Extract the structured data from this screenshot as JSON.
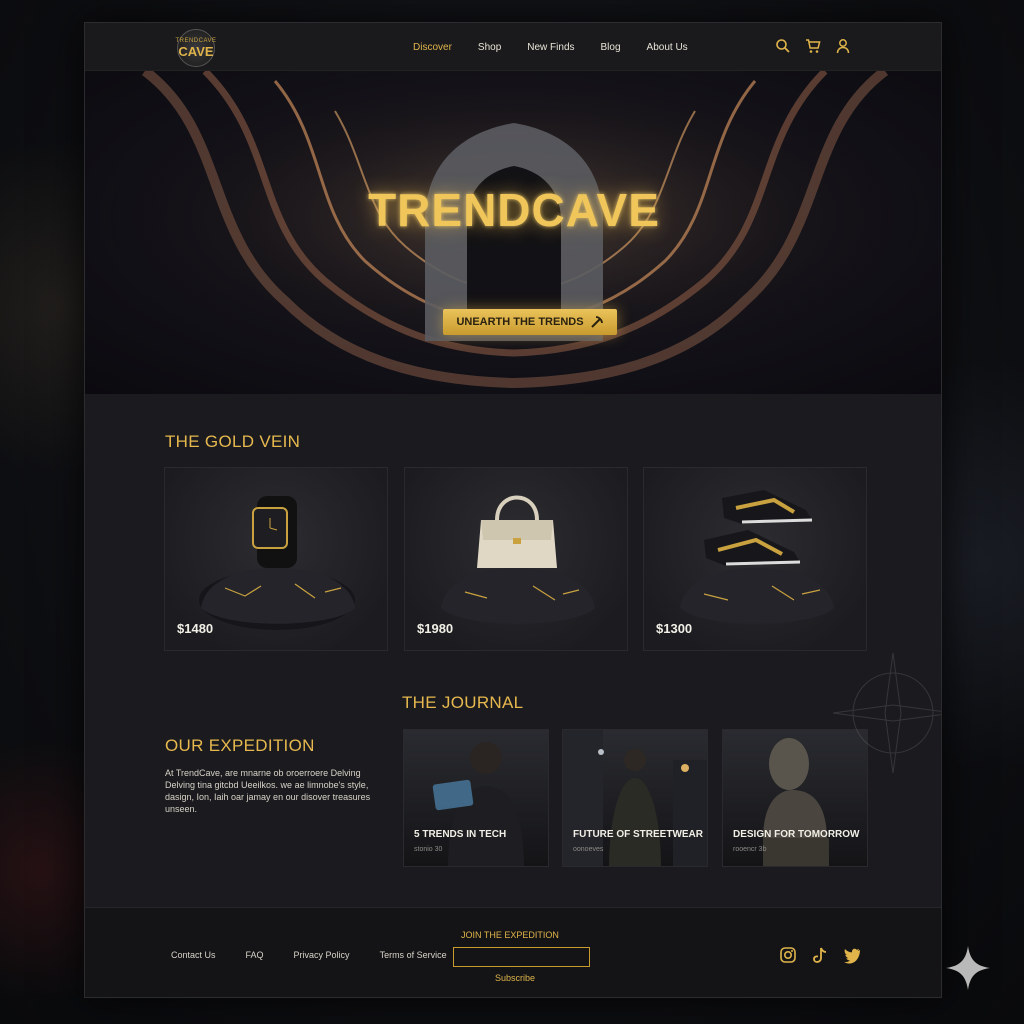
{
  "brand": {
    "logo_top": "TRENDCAVE",
    "logo_main": "CAVE"
  },
  "nav": {
    "items": [
      {
        "label": "Discover",
        "active": true
      },
      {
        "label": "Shop",
        "active": false
      },
      {
        "label": "New Finds",
        "active": false
      },
      {
        "label": "Blog",
        "active": false
      },
      {
        "label": "About Us",
        "active": false
      }
    ]
  },
  "header_icons": [
    "search-icon",
    "cart-icon",
    "user-icon"
  ],
  "hero": {
    "title": "TRENDCAVE",
    "cta_label": "UNEARTH THE TRENDS"
  },
  "gold_vein": {
    "title": "THE GOLD VEIN",
    "products": [
      {
        "name": "watch",
        "price": "$1480"
      },
      {
        "name": "handbag",
        "price": "$1980"
      },
      {
        "name": "sneakers",
        "price": "$1300"
      }
    ]
  },
  "expedition": {
    "title": "OUR EXPEDITION",
    "text": "At TrendCave, are mnarne ob oroerroere Delving Delving tina gitcbd Ueeilkos. we ae limnobe's style, dasign, Ion, Iaih oar jamay en our disover treasures unseen."
  },
  "journal": {
    "title": "THE JOURNAL",
    "articles": [
      {
        "title": "5 TRENDS IN TECH",
        "sub": "stonio 30"
      },
      {
        "title": "FUTURE OF STREETWEAR",
        "sub": "oonoeves"
      },
      {
        "title": "DESIGN FOR TOMORROW",
        "sub": "rooencr 3b"
      }
    ]
  },
  "footer": {
    "links": [
      "Contact Us",
      "FAQ",
      "Privacy Policy",
      "Terms of Service"
    ],
    "join_label": "JOIN THE EXPEDITION",
    "email_value": "",
    "subscribe_label": "Subscribe",
    "social": [
      "instagram-icon",
      "tiktok-icon",
      "twitter-icon"
    ]
  },
  "colors": {
    "accent": "#e0b44a",
    "background": "#1b1b1f",
    "text": "#e9e4d8"
  }
}
